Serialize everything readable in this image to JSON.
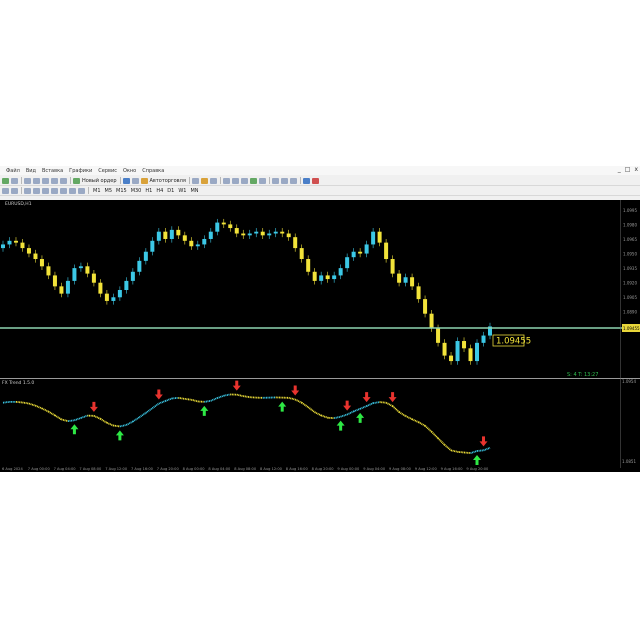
{
  "menu": {
    "items": [
      "Файл",
      "Вид",
      "Вставка",
      "Графики",
      "Сервис",
      "Окно",
      "Справка"
    ],
    "win_controls": [
      "_",
      "□",
      "x"
    ]
  },
  "toolbar": {
    "new_order": "Новый ордер",
    "autotrading": "Автоторговля",
    "timeframes": [
      "M1",
      "M5",
      "M15",
      "M30",
      "H1",
      "H4",
      "D1",
      "W1",
      "MN"
    ]
  },
  "chart": {
    "symbol_label": "EURUSD,H1",
    "price_label": "1.09455",
    "bid_axis_value": "1.09455",
    "price_axis": [
      "1.0995",
      "1.0980",
      "1.0965",
      "1.0950",
      "1.0935",
      "1.0920",
      "1.0905",
      "1.0890",
      "1.0875"
    ],
    "indicator_label": "FX Trend 1.5.0",
    "indicator_axis": [
      "1.0954",
      "1.0851"
    ],
    "status_text": "S: 4  T: 13:27",
    "time_labels": [
      "6 Aug 2024",
      "7 Aug 00:00",
      "7 Aug 04:00",
      "7 Aug 08:00",
      "7 Aug 12:00",
      "7 Aug 16:00",
      "7 Aug 20:00",
      "8 Aug 00:00",
      "8 Aug 04:00",
      "8 Aug 08:00",
      "8 Aug 12:00",
      "8 Aug 16:00",
      "8 Aug 20:00",
      "9 Aug 00:00",
      "9 Aug 04:00",
      "9 Aug 08:00",
      "9 Aug 12:00",
      "9 Aug 16:00",
      "9 Aug 20:00"
    ],
    "colors": {
      "bull": "#3cc8e6",
      "bear": "#f2e33a",
      "horizontal_line": "#8ed4b0",
      "up_arrow": "#2ee845",
      "down_arrow": "#e8332e"
    }
  },
  "chart_data": {
    "type": "candlestick",
    "symbol": "EURUSD",
    "timeframe": "H1",
    "closes": [
      1.0985,
      1.0987,
      1.0986,
      1.0983,
      1.098,
      1.0977,
      1.0973,
      1.0968,
      1.0962,
      1.0958,
      1.0965,
      1.0972,
      1.0973,
      1.0969,
      1.0964,
      1.0958,
      1.0954,
      1.0956,
      1.096,
      1.0965,
      1.097,
      1.0976,
      1.0981,
      1.0987,
      1.0992,
      1.0988,
      1.0993,
      1.099,
      1.0987,
      1.0984,
      1.0985,
      1.0988,
      1.0992,
      1.0997,
      1.0996,
      1.0994,
      1.0991,
      1.099,
      1.0991,
      1.0992,
      1.099,
      1.0991,
      1.0992,
      1.0991,
      1.0989,
      1.0983,
      1.0977,
      1.097,
      1.0965,
      1.0968,
      1.0966,
      1.0968,
      1.0972,
      1.0978,
      1.0981,
      1.098,
      1.0985,
      1.0992,
      1.0986,
      1.0977,
      1.0969,
      1.0964,
      1.0967,
      1.0962,
      1.0955,
      1.0947,
      1.0939,
      1.0931,
      1.0924,
      1.0921,
      1.0932,
      1.0928,
      1.0921,
      1.0931,
      1.0935,
      1.094
    ],
    "indicator": {
      "name": "FX Trend",
      "signals": [
        {
          "bar": 11,
          "type": "buy"
        },
        {
          "bar": 14,
          "type": "sell"
        },
        {
          "bar": 18,
          "type": "buy"
        },
        {
          "bar": 24,
          "type": "sell"
        },
        {
          "bar": 31,
          "type": "buy"
        },
        {
          "bar": 36,
          "type": "sell"
        },
        {
          "bar": 43,
          "type": "buy"
        },
        {
          "bar": 45,
          "type": "sell"
        },
        {
          "bar": 52,
          "type": "buy"
        },
        {
          "bar": 53,
          "type": "sell"
        },
        {
          "bar": 55,
          "type": "buy"
        },
        {
          "bar": 56,
          "type": "sell"
        },
        {
          "bar": 60,
          "type": "sell"
        },
        {
          "bar": 73,
          "type": "buy"
        },
        {
          "bar": 74,
          "type": "sell"
        }
      ]
    }
  }
}
